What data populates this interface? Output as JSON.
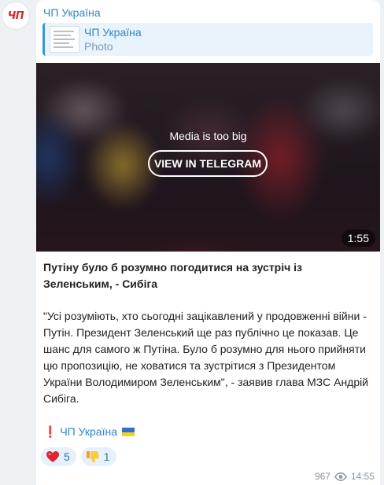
{
  "channel": {
    "avatar_text": "ЧП",
    "name": "ЧП Україна"
  },
  "reply": {
    "title": "ЧП Україна",
    "subtitle": "Photo"
  },
  "media": {
    "message": "Media is too big",
    "button_label": "VIEW IN TELEGRAM",
    "duration": "1:55"
  },
  "post": {
    "headline": "Путіну було б розумно погодитися на зустріч із Зеленським, - Сибіга",
    "body": "\"Усі розуміють, хто сьогодні зацікавлений у продовженні війни - Путін. Президент Зеленський ще раз публічно це показав. Це шанс для самого ж Путіна. Було б розумно для нього прийняти цю пропозицію, не ховатися та зустрітися з Президентом України Володимиром Зеленським\", - заявив глава МЗС Андрій Сибіга.",
    "signature_mark": "❗",
    "signature": "ЧП Україна"
  },
  "reactions": [
    {
      "icon": "heart-icon",
      "count": "5"
    },
    {
      "icon": "thumbs-down-icon",
      "count": "1"
    }
  ],
  "meta": {
    "views": "967",
    "time": "14:55"
  },
  "colors": {
    "link": "#2f87c7",
    "accent": "#3a95d6",
    "reaction_bg": "#e7f1fb",
    "brand_red": "#d6262b"
  }
}
